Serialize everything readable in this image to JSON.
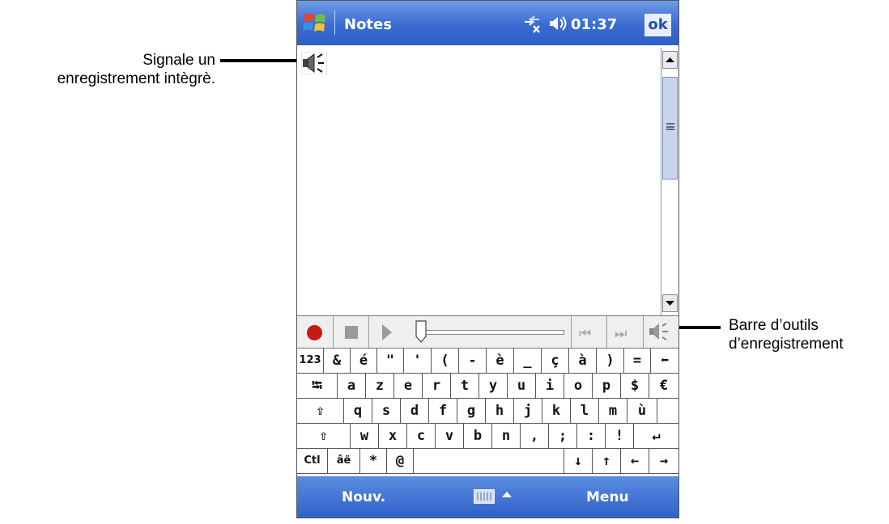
{
  "annotations": {
    "embedded_recording": [
      "Signale un",
      "enregistrement intègrè."
    ],
    "recording_toolbar": [
      "Barre d’outils",
      "d’enregistrement"
    ]
  },
  "titlebar": {
    "app_title": "Notes",
    "clock": "01:37",
    "ok_label": "ok",
    "icons": [
      "windows-start-icon",
      "connectivity-icon",
      "volume-icon"
    ]
  },
  "content": {
    "icons": [
      "embedded-recording-icon"
    ]
  },
  "recording_toolbar": {
    "buttons": [
      "record",
      "stop",
      "play",
      "position-slider",
      "skip-back",
      "skip-forward",
      "speaker"
    ],
    "skip_back_label": "⏮",
    "skip_forward_label": "⏭"
  },
  "keyboard": {
    "rows": [
      [
        "123",
        "&",
        "é",
        "\"",
        "'",
        "(",
        "-",
        "è",
        "_",
        "ç",
        "à",
        ")",
        "=",
        "⬅"
      ],
      [
        "⭾",
        "a",
        "z",
        "e",
        "r",
        "t",
        "y",
        "u",
        "i",
        "o",
        "p",
        "$",
        "€"
      ],
      [
        "⇪",
        "q",
        "s",
        "d",
        "f",
        "g",
        "h",
        "j",
        "k",
        "l",
        "m",
        "ù"
      ],
      [
        "⇧",
        "w",
        "x",
        "c",
        "v",
        "b",
        "n",
        ",",
        ";",
        ":",
        "!",
        "↵"
      ],
      [
        "Ctl",
        "âë",
        "*",
        "@",
        "",
        "↓",
        "↑",
        "←",
        "→"
      ]
    ]
  },
  "menubar": {
    "left_label": "Nouv.",
    "right_label": "Menu"
  },
  "colors": {
    "title_bar": "#3a6bd2",
    "record_red": "#c81818",
    "menu_bar": "#2f62c9"
  }
}
